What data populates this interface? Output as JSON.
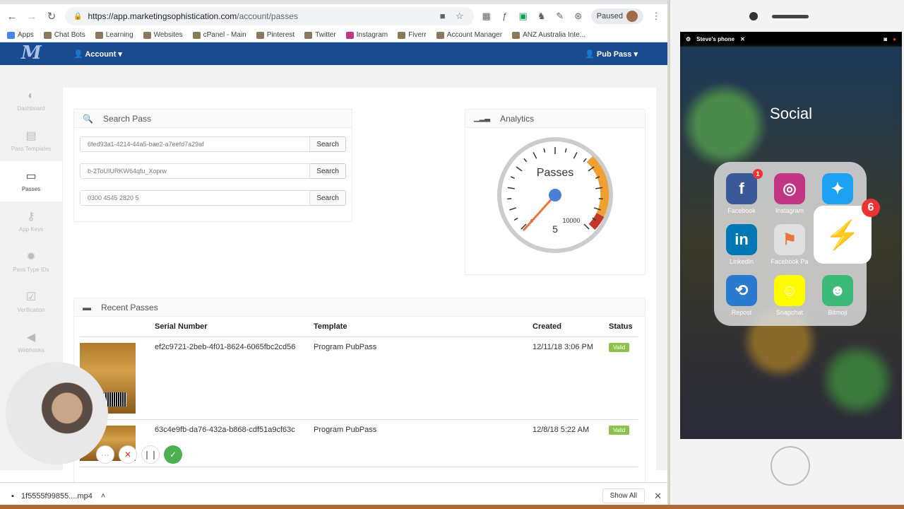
{
  "browser": {
    "url_host": "https://app.marketingsophistication.com",
    "url_path": "/account/passes",
    "paused_label": "Paused"
  },
  "bookmarks": [
    "Apps",
    "Chat Bots",
    "Learning",
    "Websites",
    "cPanel - Main",
    "Pinterest",
    "Twitter",
    "Instagram",
    "Fiverr",
    "Account Manager",
    "ANZ Australia Inte..."
  ],
  "topnav": {
    "account": "Account ▾",
    "pubpass": "Pub Pass ▾",
    "logo": "M"
  },
  "sidebar": [
    {
      "label": "Dashboard",
      "icon": "dashboard-icon",
      "glyph": "◐"
    },
    {
      "label": "Pass Templates",
      "icon": "file-icon",
      "glyph": "▤"
    },
    {
      "label": "Passes",
      "icon": "card-icon",
      "glyph": "▭"
    },
    {
      "label": "App Keys",
      "icon": "key-icon",
      "glyph": "⚷"
    },
    {
      "label": "Pass Type IDs",
      "icon": "gear-icon",
      "glyph": "✹"
    },
    {
      "label": "Verification",
      "icon": "check-icon",
      "glyph": "☑"
    },
    {
      "label": "Webhooks",
      "icon": "megaphone-icon",
      "glyph": "◀"
    }
  ],
  "search": {
    "title": "Search Pass",
    "rows": [
      {
        "value": "6fed93a1-4214-44a5-bae2-a7eefd7a29af",
        "button": "Search"
      },
      {
        "value": "b-2ToUIURKW64qfu_Xoprw",
        "button": "Search"
      },
      {
        "value": "0300 4545 2820 5",
        "button": "Search"
      }
    ]
  },
  "analytics": {
    "title": "Analytics",
    "gauge_label": "Passes",
    "gauge_value": "5",
    "gauge_max": "10000",
    "gauge_min": "0"
  },
  "recent": {
    "title": "Recent Passes",
    "headers": [
      "Serial Number",
      "Template",
      "Created",
      "Status"
    ],
    "rows": [
      {
        "serial": "ef2c9721-2beb-4f01-8624-6065fbc2cd56",
        "template": "Program PubPass",
        "created": "12/11/18 3:06 PM",
        "status": "Valid"
      },
      {
        "serial": "63c4e9fb-da76-432a-b868-cdf51a9cf63c",
        "template": "Program PubPass",
        "created": "12/8/18 5:22 AM",
        "status": "Valid"
      }
    ]
  },
  "download": {
    "file": "1f5555f99855....mp4",
    "show_all": "Show All"
  },
  "phone": {
    "device_name": "Steve's phone",
    "folder_title": "Social",
    "apps": [
      {
        "name": "Facebook",
        "color": "#3b5998",
        "glyph": "f",
        "badge": "1"
      },
      {
        "name": "Instagram",
        "color": "#c13584",
        "glyph": "◎",
        "badge": ""
      },
      {
        "name": "Twitter",
        "color": "#1da1f2",
        "glyph": "✦",
        "badge": ""
      },
      {
        "name": "LinkedIn",
        "color": "#0077b5",
        "glyph": "in",
        "badge": ""
      },
      {
        "name": "Facebook Pa",
        "color": "#e0e0e0",
        "glyph": "⚑",
        "badge": ""
      },
      {
        "name": "Messenger",
        "color": "#0084ff",
        "glyph": "⚡",
        "badge": "6"
      },
      {
        "name": "Repost",
        "color": "#2a7ad0",
        "glyph": "⟲",
        "badge": ""
      },
      {
        "name": "Snapchat",
        "color": "#fffc00",
        "glyph": "☺",
        "badge": ""
      },
      {
        "name": "Bitmoji",
        "color": "#3cb878",
        "glyph": "☻",
        "badge": ""
      }
    ]
  }
}
